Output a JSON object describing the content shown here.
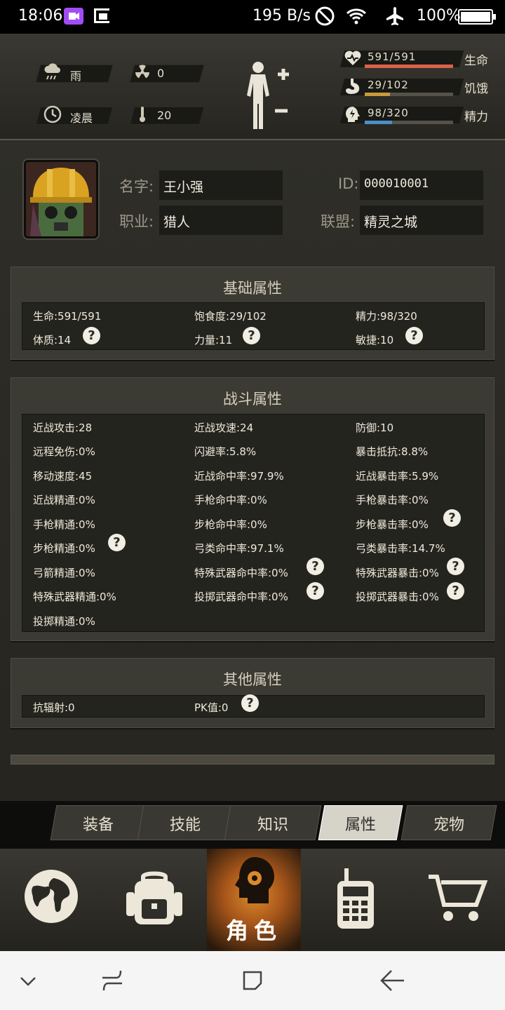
{
  "status_bar": {
    "time": "18:06",
    "speed": "195 B/s",
    "battery": "100%"
  },
  "top": {
    "weather": "雨",
    "radiation": "0",
    "time_of_day": "凌晨",
    "temperature": "20",
    "stats": [
      {
        "value": "591/591",
        "name": "生命",
        "fraction": 1.0,
        "color": "#d9624a"
      },
      {
        "value": "29/102",
        "name": "饥饿",
        "fraction": 0.284,
        "color": "#c99a3a"
      },
      {
        "value": "98/320",
        "name": "精力",
        "fraction": 0.306,
        "color": "#4b8fc9"
      }
    ]
  },
  "profile": {
    "name_label": "名字:",
    "name_value": "王小强",
    "id_label": "ID:",
    "id_value": "000010001",
    "job_label": "职业:",
    "job_value": "猎人",
    "alliance_label": "联盟:",
    "alliance_value": "精灵之城"
  },
  "basic": {
    "title": "基础属性",
    "items": [
      "生命:591/591",
      "饱食度:29/102",
      "精力:98/320",
      "体质:14",
      "力量:11",
      "敏捷:10"
    ]
  },
  "combat": {
    "title": "战斗属性",
    "items": [
      "近战攻击:28",
      "近战攻速:24",
      "防御:10",
      "远程免伤:0%",
      "闪避率:5.8%",
      "暴击抵抗:8.8%",
      "移动速度:45",
      "近战命中率:97.9%",
      "近战暴击率:5.9%",
      "近战精通:0%",
      "手枪命中率:0%",
      "手枪暴击率:0%",
      "手枪精通:0%",
      "步枪命中率:0%",
      "步枪暴击率:0%",
      "步枪精通:0%",
      "弓类命中率:97.1%",
      "弓类暴击率:14.7%",
      "弓箭精通:0%",
      "特殊武器命中率:0%",
      "特殊武器暴击:0%",
      "特殊武器精通:0%",
      "投掷武器命中率:0%",
      "投掷武器暴击:0%",
      "投掷精通:0%"
    ]
  },
  "other": {
    "title": "其他属性",
    "items": [
      "抗辐射:0",
      "PK值:0"
    ]
  },
  "tabs": [
    "装备",
    "技能",
    "知识",
    "属性",
    "宠物"
  ],
  "active_tab": "属性",
  "nav": {
    "active_label": "角色",
    "items": [
      "globe-icon",
      "backpack-icon",
      "character-icon",
      "radio-icon",
      "cart-icon"
    ]
  },
  "help_glyph": "?"
}
